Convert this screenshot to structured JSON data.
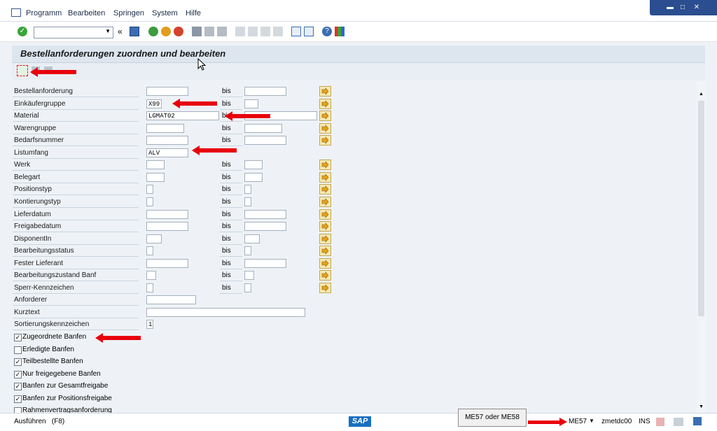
{
  "menu": {
    "items": [
      "Programm",
      "Bearbeiten",
      "Springen",
      "System",
      "Hilfe"
    ]
  },
  "screen": {
    "title": "Bestellanforderungen zuordnen und bearbeiten"
  },
  "form": {
    "bis_label": "bis",
    "rows": [
      {
        "label": "Bestellanforderung",
        "from": "",
        "to": ""
      },
      {
        "label": "Einkäufergruppe",
        "from": "X99",
        "to": ""
      },
      {
        "label": "Material",
        "from": "LGMAT02",
        "to": ""
      },
      {
        "label": "Warengruppe",
        "from": "",
        "to": ""
      },
      {
        "label": "Bedarfsnummer",
        "from": "",
        "to": ""
      },
      {
        "label": "Listumfang",
        "from": "ALV"
      },
      {
        "label": "Werk",
        "from": "",
        "to": ""
      },
      {
        "label": "Belegart",
        "from": "",
        "to": ""
      },
      {
        "label": "Positionstyp",
        "from": "",
        "to": ""
      },
      {
        "label": "Kontierungstyp",
        "from": "",
        "to": ""
      },
      {
        "label": "Lieferdatum",
        "from": "",
        "to": ""
      },
      {
        "label": "Freigabedatum",
        "from": "",
        "to": ""
      },
      {
        "label": "DisponentIn",
        "from": "",
        "to": ""
      },
      {
        "label": "Bearbeitungsstatus",
        "from": "",
        "to": ""
      },
      {
        "label": "Fester Lieferant",
        "from": "",
        "to": ""
      },
      {
        "label": "Bearbeitungszustand Banf",
        "from": "",
        "to": ""
      },
      {
        "label": "Sperr-Kennzeichen",
        "from": "",
        "to": ""
      },
      {
        "label": "Anforderer",
        "from": ""
      },
      {
        "label": "Kurztext",
        "from": ""
      },
      {
        "label": "Sortierungskennzeichen",
        "from": "1"
      }
    ],
    "checkboxes": [
      {
        "label": "Zugeordnete Banfen",
        "checked": true
      },
      {
        "label": "Erledigte Banfen",
        "checked": false
      },
      {
        "label": "Teilbestellte Banfen",
        "checked": true
      },
      {
        "label": "Nur freigegebene Banfen",
        "checked": true
      },
      {
        "label": "Banfen zur Gesamtfreigabe",
        "checked": true
      },
      {
        "label": "Banfen zur Positionsfreigabe",
        "checked": true
      },
      {
        "label": "Rahmenvertragsanforderung",
        "checked": false
      }
    ]
  },
  "status": {
    "message": "Ausführen   (F8)",
    "sap_logo": "SAP",
    "tooltip": "ME57 oder ME58",
    "transaction": "ME57",
    "server": "zmetdc00",
    "mode": "INS"
  },
  "icons": {
    "execute": "execute-icon",
    "enter": "enter-check-icon",
    "save": "save-icon",
    "help": "help-icon"
  },
  "colors": {
    "accent_red": "#e8000c",
    "window_blue": "#2a4e8f",
    "title_bg": "#dde6ef"
  }
}
